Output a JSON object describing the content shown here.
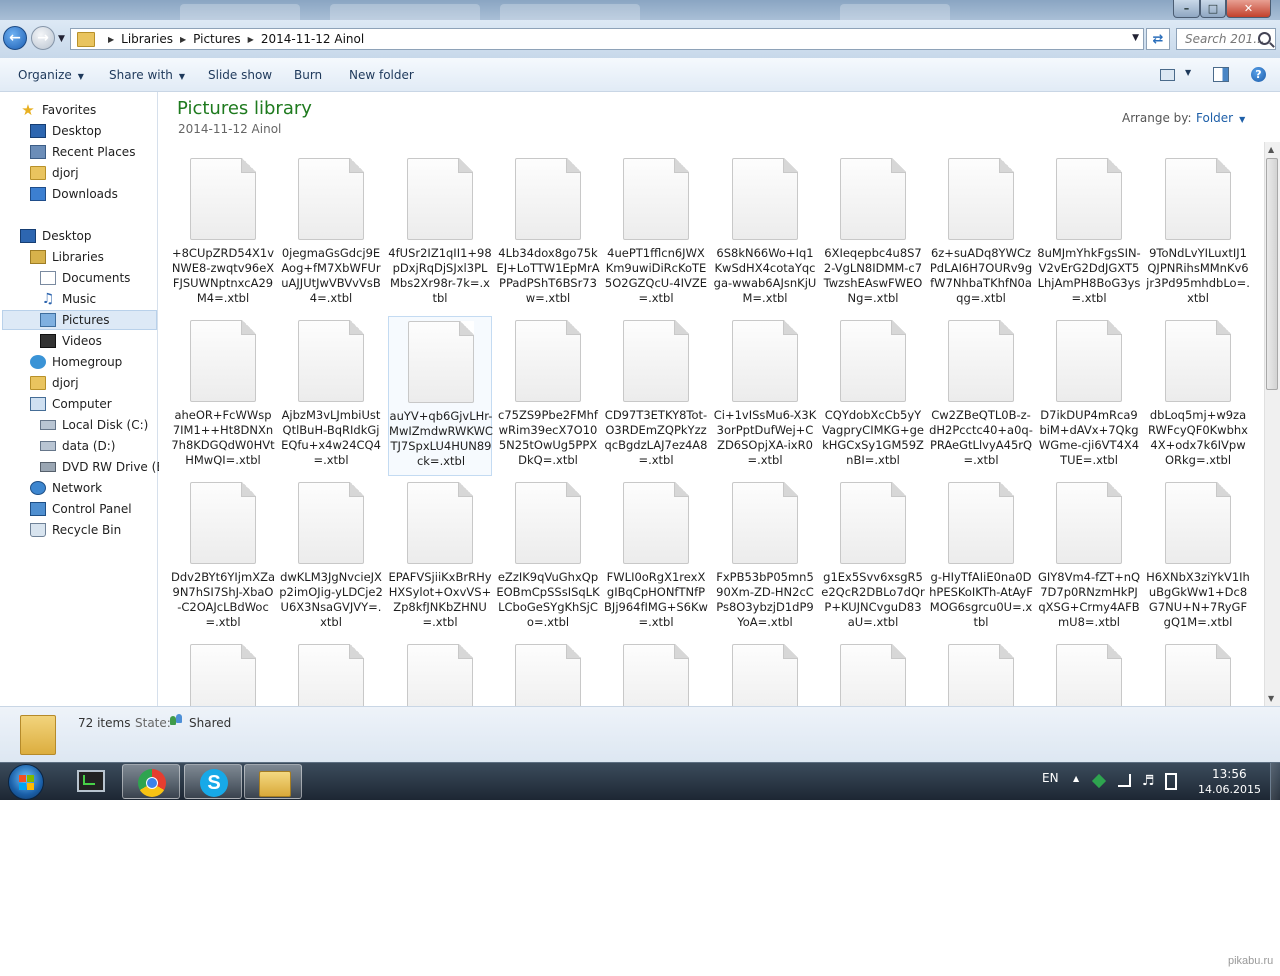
{
  "address": {
    "crumbs": [
      "Libraries",
      "Pictures",
      "2014-11-12 Ainol"
    ],
    "search_placeholder": "Search 201..."
  },
  "toolbar": {
    "organize": "Organize",
    "share_with": "Share with",
    "slide_show": "Slide show",
    "burn": "Burn",
    "new_folder": "New folder"
  },
  "nav": {
    "favorites": "Favorites",
    "desktop_fav": "Desktop",
    "recent_places": "Recent Places",
    "djorj_fav": "djorj",
    "downloads": "Downloads",
    "desktop": "Desktop",
    "libraries": "Libraries",
    "documents": "Documents",
    "music": "Music",
    "pictures": "Pictures",
    "videos": "Videos",
    "homegroup": "Homegroup",
    "djorj": "djorj",
    "computer": "Computer",
    "local_disk": "Local Disk (C:)",
    "data_disk": "data (D:)",
    "dvd_drive": "DVD RW Drive (E:)",
    "network": "Network",
    "control_panel": "Control Panel",
    "recycle_bin": "Recycle Bin"
  },
  "library": {
    "title": "Pictures library",
    "subtitle": "2014-11-12 Ainol",
    "arrange_label": "Arrange by:",
    "arrange_value": "Folder"
  },
  "files": [
    "+8CUpZRD54X1vNWE8-zwqtv96eXFJSUWNptnxcA29M4=.xtbl",
    "0jegmaGsGdcj9EAog+fM7XbWFUruAJJUtJwVBVvVsB4=.xtbl",
    "4fUSr2IZ1qII1+98pDxjRqDjSJxl3PLMbs2Xr98r-7k=.xtbl",
    "4Lb34dox8go75kEJ+LoTTW1EpMrAPPadPShT6BSr73w=.xtbl",
    "4uePT1fflcn6JWXKm9uwiDiRcKoTE5O2GZQcU-4IVZE=.xtbl",
    "6S8kN66Wo+Iq1KwSdHX4cotaYqcga-wwab6AJsnKjUM=.xtbl",
    "6XIeqepbc4u8S72-VgLN8IDMM-c7TwzshEAswFWEONg=.xtbl",
    "6z+suADq8YWCzPdLAI6H7OURv9gfW7NhbaTKhfN0aqg=.xtbl",
    "8uMJmYhkFgsSIN-V2vErG2DdJGXT5LhjAmPH8BoG3ys=.xtbl",
    "9ToNdLvYILuxtIJ1QJPNRihsMMnKv6jr3Pd95mhdbLo=.xtbl",
    "aheOR+FcWWsp7IM1++Ht8DNXn7h8KDGQdW0HVtHMwQI=.xtbl",
    "AjbzM3vLJmbiUstQtlBuH-BqRIdkGjEQfu+x4w24CQ4=.xtbl",
    "auYV+qb6GjvLHr-MwIZmdwRWKWCTJ7SpxLU4HUN89ck=.xtbl",
    "c75ZS9Pbe2FMhfwRim39ecX7O105N25tOwUg5PPXDkQ=.xtbl",
    "CD97T3ETKY8Tot-O3RDEmZQPkYzzqcBgdzLAJ7ez4A8=.xtbl",
    "Ci+1vISsMu6-X3K3orPptDufWej+CZD6SOpjXA-ixR0=.xtbl",
    "CQYdobXcCb5yYVagpryCIMKG+gekHGCxSy1GM59ZnBI=.xtbl",
    "Cw2ZBeQTL0B-z-dH2Pcctc40+a0q-PRAeGtLlvyA45rQ=.xtbl",
    "D7ikDUP4mRca9biM+dAVx+7QkgWGme-cji6VT4X4TUE=.xtbl",
    "dbLoq5mj+w9zaRWFcyQF0Kwbhx4X+odx7k6IVpwORkg=.xtbl",
    "Ddv2BYt6YIjmXZa9N7hSI7ShJ-XbaO-C2OAJcLBdWoc=.xtbl",
    "dwKLM3JgNvcieJXp2imOJig-yLDCje2U6X3NsaGVJVY=.xtbl",
    "EPAFVSjiiKxBrRHyHXSylot+OxvVS+Zp8kfJNKbZHNU=.xtbl",
    "eZzIK9qVuGhxQpEOBmCpSSsISqLKLCboGeSYgKhSjCo=.xtbl",
    "FWLI0oRgX1rexXgIBqCpHONfTNfPBJj964fIMG+S6Kw=.xtbl",
    "FxPB53bP05mn590Xm-ZD-HN2cCPs8O3ybzjD1dP9YoA=.xtbl",
    "g1Ex5Svv6xsgR5e2QcR2DBLo7dQrP+KUJNCvguD83aU=.xtbl",
    "g-HIyTfAIiE0na0DhPESKoIKTh-AtAyFMOG6sgrcu0U=.xtbl",
    "GIY8Vm4-fZT+nQ7D7p0RNzmHkPJqXSG+Crmy4AFBmU8=.xtbl",
    "H6XNbX3ziYkV1IhuBgGkWw1+Dc8G7NU+N+7RyGFgQ1M=.xtbl",
    "",
    "",
    "",
    "",
    "",
    "",
    "",
    "",
    "",
    ""
  ],
  "status": {
    "item_count": "72 items",
    "state_label": "State:",
    "state_value": "Shared"
  },
  "taskbar": {
    "language": "EN",
    "time": "13:56",
    "date": "14.06.2015"
  },
  "watermark": "pikabu.ru"
}
